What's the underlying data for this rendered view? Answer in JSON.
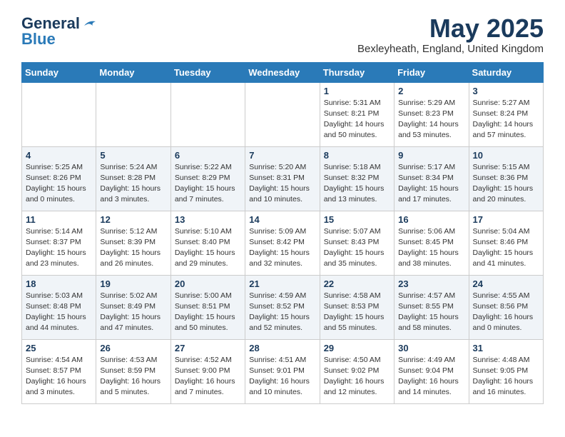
{
  "header": {
    "logo_line1": "General",
    "logo_line2": "Blue",
    "month_title": "May 2025",
    "location": "Bexleyheath, England, United Kingdom"
  },
  "days_of_week": [
    "Sunday",
    "Monday",
    "Tuesday",
    "Wednesday",
    "Thursday",
    "Friday",
    "Saturday"
  ],
  "weeks": [
    [
      {
        "day": "",
        "info": ""
      },
      {
        "day": "",
        "info": ""
      },
      {
        "day": "",
        "info": ""
      },
      {
        "day": "",
        "info": ""
      },
      {
        "day": "1",
        "info": "Sunrise: 5:31 AM\nSunset: 8:21 PM\nDaylight: 14 hours\nand 50 minutes."
      },
      {
        "day": "2",
        "info": "Sunrise: 5:29 AM\nSunset: 8:23 PM\nDaylight: 14 hours\nand 53 minutes."
      },
      {
        "day": "3",
        "info": "Sunrise: 5:27 AM\nSunset: 8:24 PM\nDaylight: 14 hours\nand 57 minutes."
      }
    ],
    [
      {
        "day": "4",
        "info": "Sunrise: 5:25 AM\nSunset: 8:26 PM\nDaylight: 15 hours\nand 0 minutes."
      },
      {
        "day": "5",
        "info": "Sunrise: 5:24 AM\nSunset: 8:28 PM\nDaylight: 15 hours\nand 3 minutes."
      },
      {
        "day": "6",
        "info": "Sunrise: 5:22 AM\nSunset: 8:29 PM\nDaylight: 15 hours\nand 7 minutes."
      },
      {
        "day": "7",
        "info": "Sunrise: 5:20 AM\nSunset: 8:31 PM\nDaylight: 15 hours\nand 10 minutes."
      },
      {
        "day": "8",
        "info": "Sunrise: 5:18 AM\nSunset: 8:32 PM\nDaylight: 15 hours\nand 13 minutes."
      },
      {
        "day": "9",
        "info": "Sunrise: 5:17 AM\nSunset: 8:34 PM\nDaylight: 15 hours\nand 17 minutes."
      },
      {
        "day": "10",
        "info": "Sunrise: 5:15 AM\nSunset: 8:36 PM\nDaylight: 15 hours\nand 20 minutes."
      }
    ],
    [
      {
        "day": "11",
        "info": "Sunrise: 5:14 AM\nSunset: 8:37 PM\nDaylight: 15 hours\nand 23 minutes."
      },
      {
        "day": "12",
        "info": "Sunrise: 5:12 AM\nSunset: 8:39 PM\nDaylight: 15 hours\nand 26 minutes."
      },
      {
        "day": "13",
        "info": "Sunrise: 5:10 AM\nSunset: 8:40 PM\nDaylight: 15 hours\nand 29 minutes."
      },
      {
        "day": "14",
        "info": "Sunrise: 5:09 AM\nSunset: 8:42 PM\nDaylight: 15 hours\nand 32 minutes."
      },
      {
        "day": "15",
        "info": "Sunrise: 5:07 AM\nSunset: 8:43 PM\nDaylight: 15 hours\nand 35 minutes."
      },
      {
        "day": "16",
        "info": "Sunrise: 5:06 AM\nSunset: 8:45 PM\nDaylight: 15 hours\nand 38 minutes."
      },
      {
        "day": "17",
        "info": "Sunrise: 5:04 AM\nSunset: 8:46 PM\nDaylight: 15 hours\nand 41 minutes."
      }
    ],
    [
      {
        "day": "18",
        "info": "Sunrise: 5:03 AM\nSunset: 8:48 PM\nDaylight: 15 hours\nand 44 minutes."
      },
      {
        "day": "19",
        "info": "Sunrise: 5:02 AM\nSunset: 8:49 PM\nDaylight: 15 hours\nand 47 minutes."
      },
      {
        "day": "20",
        "info": "Sunrise: 5:00 AM\nSunset: 8:51 PM\nDaylight: 15 hours\nand 50 minutes."
      },
      {
        "day": "21",
        "info": "Sunrise: 4:59 AM\nSunset: 8:52 PM\nDaylight: 15 hours\nand 52 minutes."
      },
      {
        "day": "22",
        "info": "Sunrise: 4:58 AM\nSunset: 8:53 PM\nDaylight: 15 hours\nand 55 minutes."
      },
      {
        "day": "23",
        "info": "Sunrise: 4:57 AM\nSunset: 8:55 PM\nDaylight: 15 hours\nand 58 minutes."
      },
      {
        "day": "24",
        "info": "Sunrise: 4:55 AM\nSunset: 8:56 PM\nDaylight: 16 hours\nand 0 minutes."
      }
    ],
    [
      {
        "day": "25",
        "info": "Sunrise: 4:54 AM\nSunset: 8:57 PM\nDaylight: 16 hours\nand 3 minutes."
      },
      {
        "day": "26",
        "info": "Sunrise: 4:53 AM\nSunset: 8:59 PM\nDaylight: 16 hours\nand 5 minutes."
      },
      {
        "day": "27",
        "info": "Sunrise: 4:52 AM\nSunset: 9:00 PM\nDaylight: 16 hours\nand 7 minutes."
      },
      {
        "day": "28",
        "info": "Sunrise: 4:51 AM\nSunset: 9:01 PM\nDaylight: 16 hours\nand 10 minutes."
      },
      {
        "day": "29",
        "info": "Sunrise: 4:50 AM\nSunset: 9:02 PM\nDaylight: 16 hours\nand 12 minutes."
      },
      {
        "day": "30",
        "info": "Sunrise: 4:49 AM\nSunset: 9:04 PM\nDaylight: 16 hours\nand 14 minutes."
      },
      {
        "day": "31",
        "info": "Sunrise: 4:48 AM\nSunset: 9:05 PM\nDaylight: 16 hours\nand 16 minutes."
      }
    ]
  ]
}
